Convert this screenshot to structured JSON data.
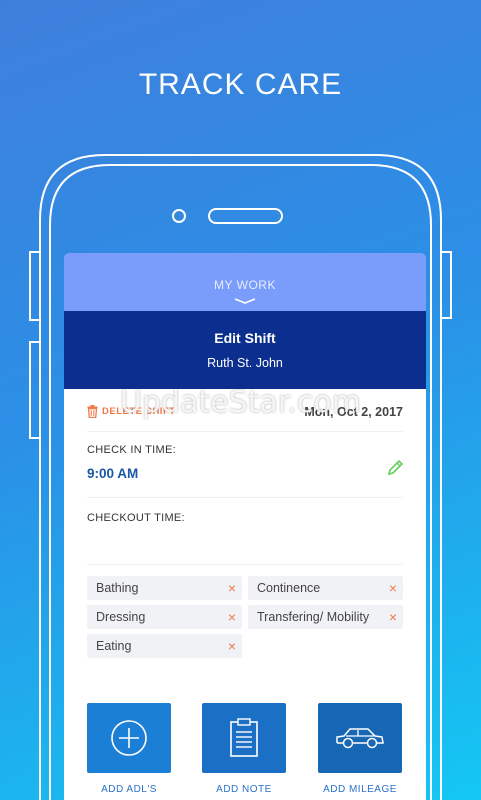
{
  "headline": "TRACK CARE",
  "tab": {
    "label": "MY WORK"
  },
  "header": {
    "title": "Edit Shift",
    "subtitle": "Ruth St. John"
  },
  "shift": {
    "delete_label": "DELETE SHIFT",
    "date": "Mon, Oct 2, 2017",
    "checkin_label": "CHECK IN TIME:",
    "checkin_value": "9:00 AM",
    "checkout_label": "CHECKOUT TIME:"
  },
  "tags": [
    {
      "label": "Bathing"
    },
    {
      "label": "Continence"
    },
    {
      "label": "Dressing"
    },
    {
      "label": "Transfering/ Mobility"
    },
    {
      "label": "Eating"
    }
  ],
  "tag_remove_symbol": "×",
  "actions": [
    {
      "label": "ADD ADL'S",
      "icon": "plus-circle-icon",
      "color": "#1c7fd6"
    },
    {
      "label": "ADD NOTE",
      "icon": "clipboard-icon",
      "color": "#1b6fc4"
    },
    {
      "label": "ADD MILEAGE",
      "icon": "car-icon",
      "color": "#1867b4"
    }
  ],
  "watermark": "UpdateStar.com",
  "colors": {
    "accent": "#1b57a6",
    "header_bg": "#0c2f8f",
    "tab_bg": "#7a9dfb",
    "delete": "#f07a4b",
    "edit": "#5fcf5a"
  }
}
